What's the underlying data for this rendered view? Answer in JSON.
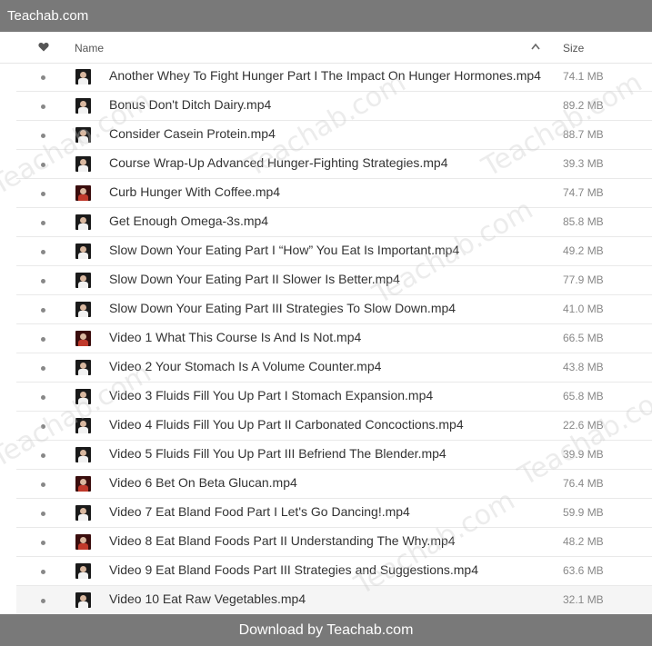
{
  "topbar": {
    "title": "Teachab.com"
  },
  "header": {
    "name_label": "Name",
    "size_label": "Size"
  },
  "files": [
    {
      "name": "Another Whey To Fight Hunger Part I The Impact On Hunger Hormones.mp4",
      "size": "74.1 MB"
    },
    {
      "name": "Bonus Don't Ditch Dairy.mp4",
      "size": "89.2 MB"
    },
    {
      "name": "Consider Casein Protein.mp4",
      "size": "88.7 MB"
    },
    {
      "name": "Course Wrap-Up Advanced Hunger-Fighting Strategies.mp4",
      "size": "39.3 MB"
    },
    {
      "name": "Curb Hunger With Coffee.mp4",
      "size": "74.7 MB"
    },
    {
      "name": "Get Enough Omega-3s.mp4",
      "size": "85.8 MB"
    },
    {
      "name": "Slow Down Your Eating Part I “How” You Eat Is Important.mp4",
      "size": "49.2 MB"
    },
    {
      "name": "Slow Down Your Eating Part II Slower Is Better.mp4",
      "size": "77.9 MB"
    },
    {
      "name": "Slow Down Your Eating Part III Strategies To Slow Down.mp4",
      "size": "41.0 MB"
    },
    {
      "name": "Video 1 What This Course Is And Is Not.mp4",
      "size": "66.5 MB"
    },
    {
      "name": "Video 2 Your Stomach Is A Volume Counter.mp4",
      "size": "43.8 MB"
    },
    {
      "name": "Video 3 Fluids Fill You Up Part I Stomach Expansion.mp4",
      "size": "65.8 MB"
    },
    {
      "name": "Video 4 Fluids Fill You Up Part II Carbonated Concoctions.mp4",
      "size": "22.6 MB"
    },
    {
      "name": "Video 5 Fluids Fill You Up Part III Befriend The Blender.mp4",
      "size": "39.9 MB"
    },
    {
      "name": "Video 6 Bet On Beta Glucan.mp4",
      "size": "76.4 MB"
    },
    {
      "name": "Video 7 Eat Bland Food Part I Let's Go Dancing!.mp4",
      "size": "59.9 MB"
    },
    {
      "name": "Video 8 Eat Bland Foods Part II Understanding The Why.mp4",
      "size": "48.2 MB"
    },
    {
      "name": "Video 9 Eat Bland Foods Part III Strategies and Suggestions.mp4",
      "size": "63.6 MB"
    },
    {
      "name": "Video 10 Eat Raw Vegetables.mp4",
      "size": "32.1 MB"
    }
  ],
  "footer": {
    "text": "Download by Teachab.com"
  },
  "watermark": "Teachab.com",
  "colors": {
    "bar": "#797979",
    "row_border": "#e9e9e9",
    "text": "#333333",
    "size_text": "#888888"
  },
  "icons": {
    "favorite": "heart-icon",
    "sort": "sort-up-icon",
    "row_marker": "bullet-icon",
    "thumbnail": "video-thumbnail-icon"
  }
}
